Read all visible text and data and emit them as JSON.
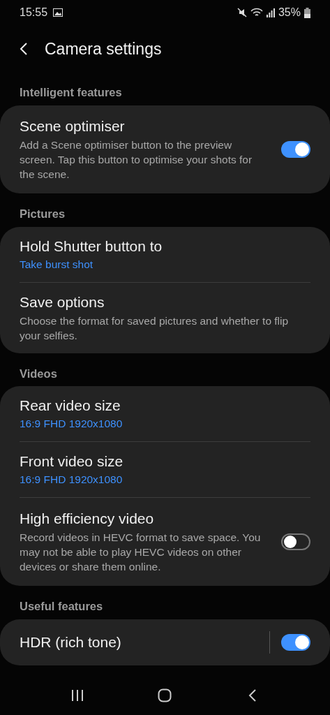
{
  "status_bar": {
    "time": "15:55",
    "battery": "35%"
  },
  "header": {
    "title": "Camera settings"
  },
  "sections": [
    {
      "label": "Intelligent features",
      "items": [
        {
          "kind": "toggle",
          "title": "Scene optimiser",
          "description": "Add a Scene optimiser button to the preview screen. Tap this button to optimise your shots for the scene.",
          "on": true
        }
      ]
    },
    {
      "label": "Pictures",
      "items": [
        {
          "kind": "value",
          "title": "Hold Shutter button to",
          "value": "Take burst shot"
        },
        {
          "kind": "text",
          "title": "Save options",
          "description": "Choose the format for saved pictures and whether to flip your selfies."
        }
      ]
    },
    {
      "label": "Videos",
      "items": [
        {
          "kind": "value",
          "title": "Rear video size",
          "value": "16:9 FHD 1920x1080"
        },
        {
          "kind": "value",
          "title": "Front video size",
          "value": "16:9 FHD 1920x1080"
        },
        {
          "kind": "toggle",
          "title": "High efficiency video",
          "description": "Record videos in HEVC format to save space. You may not be able to play HEVC videos on other devices or share them online.",
          "on": false
        }
      ]
    },
    {
      "label": "Useful features",
      "items": [
        {
          "kind": "toggle",
          "title": "HDR (rich tone)",
          "on": true,
          "divider": true
        }
      ]
    }
  ]
}
